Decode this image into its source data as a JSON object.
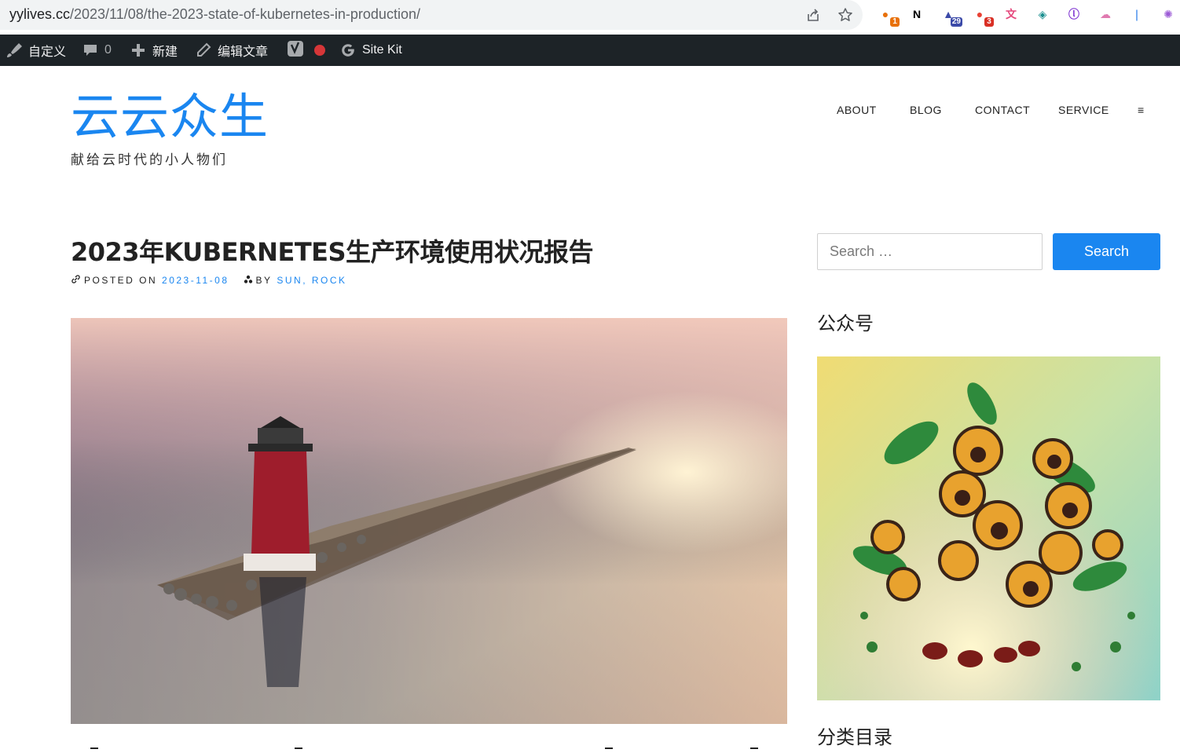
{
  "browser": {
    "url_host": "yylives.cc",
    "url_path": "/2023/11/08/the-2023-state-of-kubernetes-in-production/",
    "extensions": [
      {
        "name": "extension-1-icon",
        "badge": "1",
        "color": "#e8710a",
        "badge_color": "#e8710a"
      },
      {
        "name": "notion-icon",
        "badge": "",
        "color": "#000000"
      },
      {
        "name": "extension-graduation-icon",
        "badge": "29",
        "color": "#3b4aa8",
        "badge_color": "#3b4aa8"
      },
      {
        "name": "extension-3-icon",
        "badge": "3",
        "color": "#e94235",
        "badge_color": "#d93025"
      },
      {
        "name": "translate-icon",
        "badge": "",
        "color": "#e5477c"
      },
      {
        "name": "extension-grid-icon",
        "badge": "",
        "color": "#1b8f8f"
      },
      {
        "name": "extension-lr-icon",
        "badge": "",
        "color": "#7b2fd0"
      },
      {
        "name": "extension-cloud-icon",
        "badge": "",
        "color": "#e07ab0"
      },
      {
        "name": "extension-feather-icon",
        "badge": "",
        "color": "#1a73e8"
      },
      {
        "name": "openai-icon",
        "badge": "",
        "color": "#9c5bd6"
      }
    ]
  },
  "adminbar": {
    "customize": "自定义",
    "comments_count": "0",
    "new": "新建",
    "edit": "编辑文章",
    "sitekit": "Site Kit"
  },
  "header": {
    "site_title": "云云众生",
    "site_description": "献给云时代的小人物们",
    "nav": [
      "ABOUT",
      "BLOG",
      "CONTACT",
      "SERVICE",
      "≡"
    ]
  },
  "post": {
    "title": "2023年KUBERNETES生产环境使用状况报告",
    "posted_on_label": "POSTED ON",
    "date": "2023-11-08",
    "by_label": "BY",
    "author": "SUN, ROCK"
  },
  "sidebar": {
    "search_placeholder": "Search …",
    "search_button": "Search",
    "widget1_title": "公众号",
    "widget2_title": "分类目录"
  },
  "colors": {
    "accent": "#1a86f0",
    "adminbar_bg": "#1d2327"
  }
}
